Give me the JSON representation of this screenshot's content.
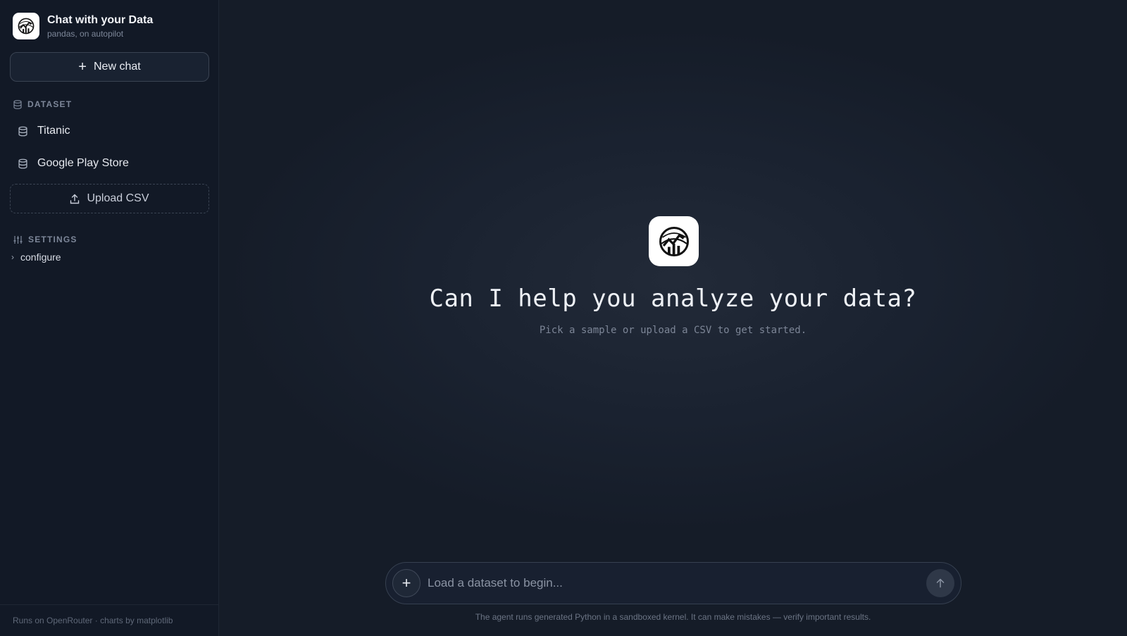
{
  "sidebar": {
    "brand": {
      "title": "Chat with your Data",
      "subtitle": "pandas, on autopilot",
      "logo_icon": "chart-globe-logo-icon"
    },
    "new_chat_label": "New chat",
    "dataset_section": {
      "label": "DATASET",
      "items": [
        {
          "label": "Titanic",
          "icon": "database-icon"
        },
        {
          "label": "Google Play Store",
          "icon": "database-icon"
        }
      ],
      "upload_label": "Upload CSV"
    },
    "settings_section": {
      "label": "SETTINGS",
      "configure_label": "configure"
    },
    "footer_text": "Runs on OpenRouter · charts by matplotlib"
  },
  "main": {
    "hero_title": "Can I help you analyze your data?",
    "hero_subtitle": "Pick a sample or upload a CSV to get started.",
    "composer": {
      "placeholder": "Load a dataset to begin...",
      "value": ""
    },
    "disclaimer": "The agent runs generated Python in a sandboxed kernel. It can make mistakes — verify important results."
  },
  "colors": {
    "background": "#151c28",
    "sidebar": "#121926",
    "text_primary": "#e6e9ef",
    "text_muted": "#7d8799",
    "logo_bg": "#ffffff"
  }
}
